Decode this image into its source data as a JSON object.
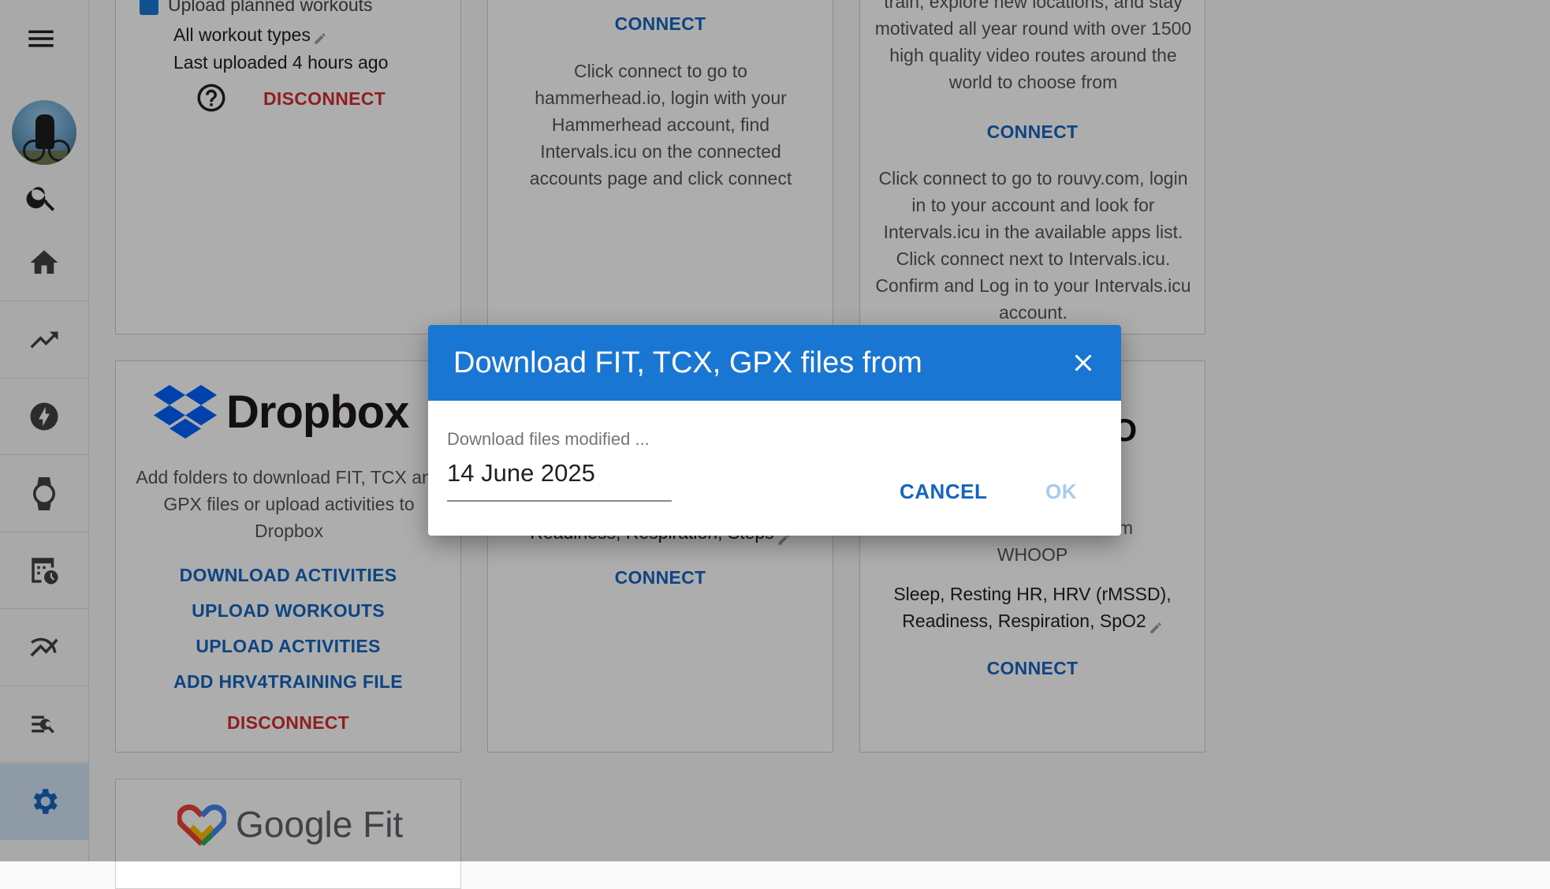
{
  "sidebar": {
    "icons": [
      "menu-icon",
      "avatar",
      "search-icon",
      "home-icon",
      "trending-up-icon",
      "bolt-icon",
      "watch-icon",
      "calendar-clock-icon",
      "multiline-chart-icon",
      "list-search-icon",
      "settings-icon"
    ],
    "active": "settings-icon"
  },
  "col1_top": {
    "checkbox_label": "Upload planned workouts",
    "workout_types": "All workout types",
    "last_uploaded": "Last uploaded 4 hours ago",
    "disconnect": "DISCONNECT"
  },
  "col2_top": {
    "connect": "CONNECT",
    "description": "Click connect to go to hammerhead.io, login with your Hammerhead account, find Intervals.icu on the connected accounts page and click connect"
  },
  "col3_top": {
    "blurb": "train, explore new locations, and stay motivated all year round with over 1500 high quality video routes around the world to choose from",
    "connect": "CONNECT",
    "description": "Click connect to go to rouvy.com, login in to your account and look for Intervals.icu in the available apps list. Click connect next to Intervals.icu. Confirm and Log in to your Intervals.icu account."
  },
  "dropbox": {
    "brand": "Dropbox",
    "description": "Add folders to download FIT, TCX and GPX files or upload activities to Dropbox",
    "download_activities": "DOWNLOAD ACTIVITIES",
    "upload_workouts": "UPLOAD WORKOUTS",
    "upload_activities": "UPLOAD ACTIVITIES",
    "add_hrv4training": "ADD HRV4TRAINING FILE",
    "disconnect": "DISCONNECT"
  },
  "col2_mid": {
    "metrics": "Readiness, Respiration, Steps",
    "connect": "CONNECT"
  },
  "whoop": {
    "logo_tail": "O",
    "description_tail": "from",
    "description_end": "WHOOP",
    "metrics_line1": "Sleep, Resting HR, HRV (rMSSD),",
    "metrics_line2": "Readiness, Respiration, SpO2",
    "connect": "CONNECT"
  },
  "googlefit": {
    "brand": "Google Fit"
  },
  "dialog": {
    "title": "Download FIT, TCX, GPX files from",
    "field_label": "Download files modified ...",
    "field_value": "14 June 2025",
    "cancel": "CANCEL",
    "ok": "OK"
  }
}
